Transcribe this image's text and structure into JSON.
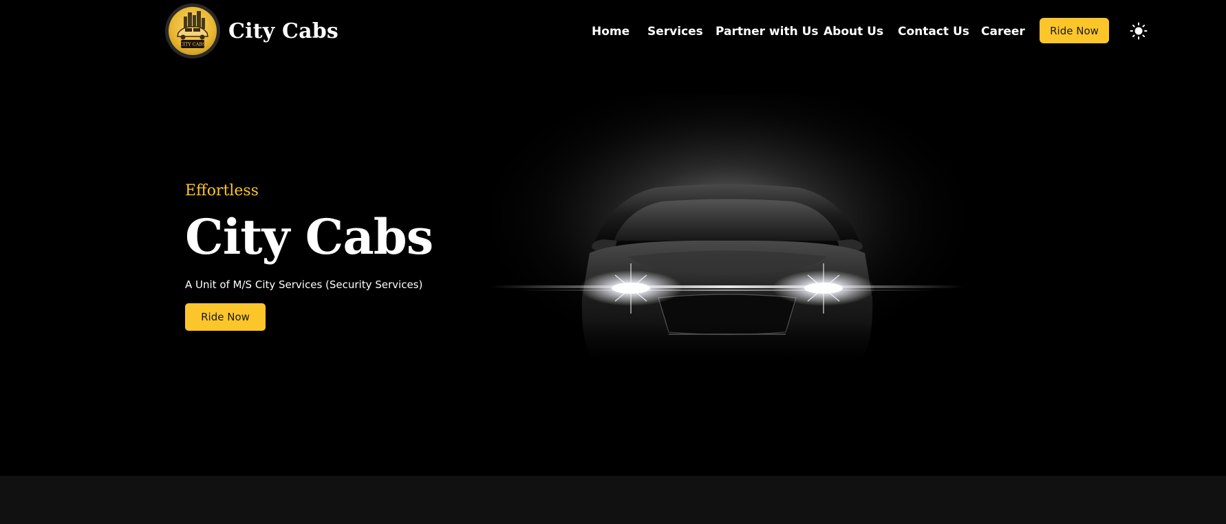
{
  "brand": {
    "name": "City Cabs",
    "logo_text": "CITY CABS",
    "logo_icon": "car-skyline-logo"
  },
  "nav": {
    "items": [
      {
        "label": "Home"
      },
      {
        "label": "Services"
      },
      {
        "label": "Partner with Us"
      },
      {
        "label": "About Us"
      },
      {
        "label": "Contact Us"
      },
      {
        "label": "Career"
      }
    ],
    "cta_label": "Ride Now",
    "theme_icon": "sun-icon"
  },
  "hero": {
    "eyebrow": "Effortless",
    "title": "City Cabs",
    "subtitle": "A Unit of M/S City Services (Security Services)",
    "cta_label": "Ride Now",
    "image": "car-headlights-image"
  },
  "colors": {
    "accent": "#fcc62b",
    "background": "#000000",
    "band": "#111111"
  }
}
